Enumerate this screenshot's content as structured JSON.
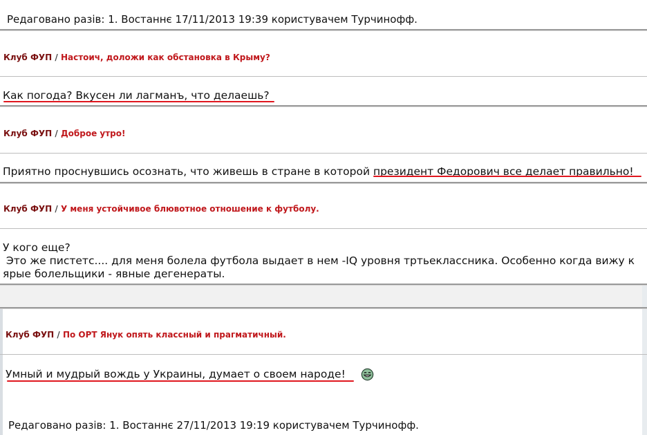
{
  "posts": [
    {
      "club": "Клуб ФУП",
      "separator": "/",
      "title": "Настоич, доложи как обстановка в Крыму?",
      "body": "Как погода? Вкусен ли лагманъ, что делаешь?"
    },
    {
      "club": "Клуб ФУП",
      "separator": "/",
      "title": "Доброе утро!",
      "body": "Приятно проснувшись осознать, что живешь в стране в которой президент Федорович  все делает правильно!"
    },
    {
      "club": "Клуб ФУП",
      "separator": "/",
      "title": "У меня устойчивое блювотное отношение к футболу.",
      "body_lines": [
        "У кого еще?",
        " Это же пистетс.... для меня болела футбола выдает в нем -IQ уровня тртьеклассника. Особенно когда вижу к",
        "ярые болельщики - явные дегенераты."
      ]
    },
    {
      "club": "Клуб ФУП",
      "separator": "/",
      "title": "По ОРТ Янук опять классный и прагматичный.",
      "body": "Умный и мудрый вождь у Украины, думает о своем народе!"
    }
  ],
  "edit_notes": [
    "Редаговано разів: 1. Востаннє 17/11/2013 19:39 користувачем Турчинофф.",
    "Редаговано разів: 1. Востаннє 27/11/2013 19:19 користувачем Турчинофф."
  ],
  "icons": {
    "smiley": "laughing-smiley-icon"
  },
  "colors": {
    "club": "#7a1010",
    "topic": "#c0181c",
    "underline": "#e0161e",
    "separator": "#9a9a9a"
  }
}
